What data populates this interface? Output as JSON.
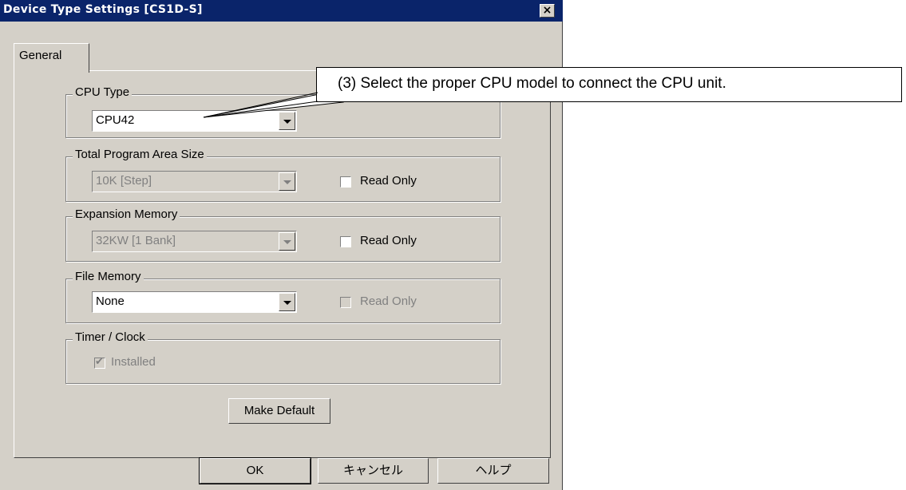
{
  "window": {
    "title": "Device Type Settings [CS1D-S]",
    "close_glyph": "✕"
  },
  "tabs": [
    {
      "label": "General"
    }
  ],
  "groups": {
    "cpu_type": {
      "label": "CPU Type",
      "value": "CPU42"
    },
    "program_area": {
      "label": "Total Program Area Size",
      "value": "10K [Step]",
      "read_only_label": "Read Only"
    },
    "expansion_memory": {
      "label": "Expansion Memory",
      "value": "32KW [1 Bank]",
      "read_only_label": "Read Only"
    },
    "file_memory": {
      "label": "File Memory",
      "value": "None",
      "read_only_label": "Read Only"
    },
    "timer_clock": {
      "label": "Timer / Clock",
      "installed_label": "Installed",
      "installed_checked": true
    }
  },
  "buttons": {
    "make_default": "Make Default",
    "ok": "OK",
    "cancel": "キャンセル",
    "help": "ヘルプ"
  },
  "callout": {
    "text": "(3) Select the proper CPU model to connect the CPU unit."
  }
}
